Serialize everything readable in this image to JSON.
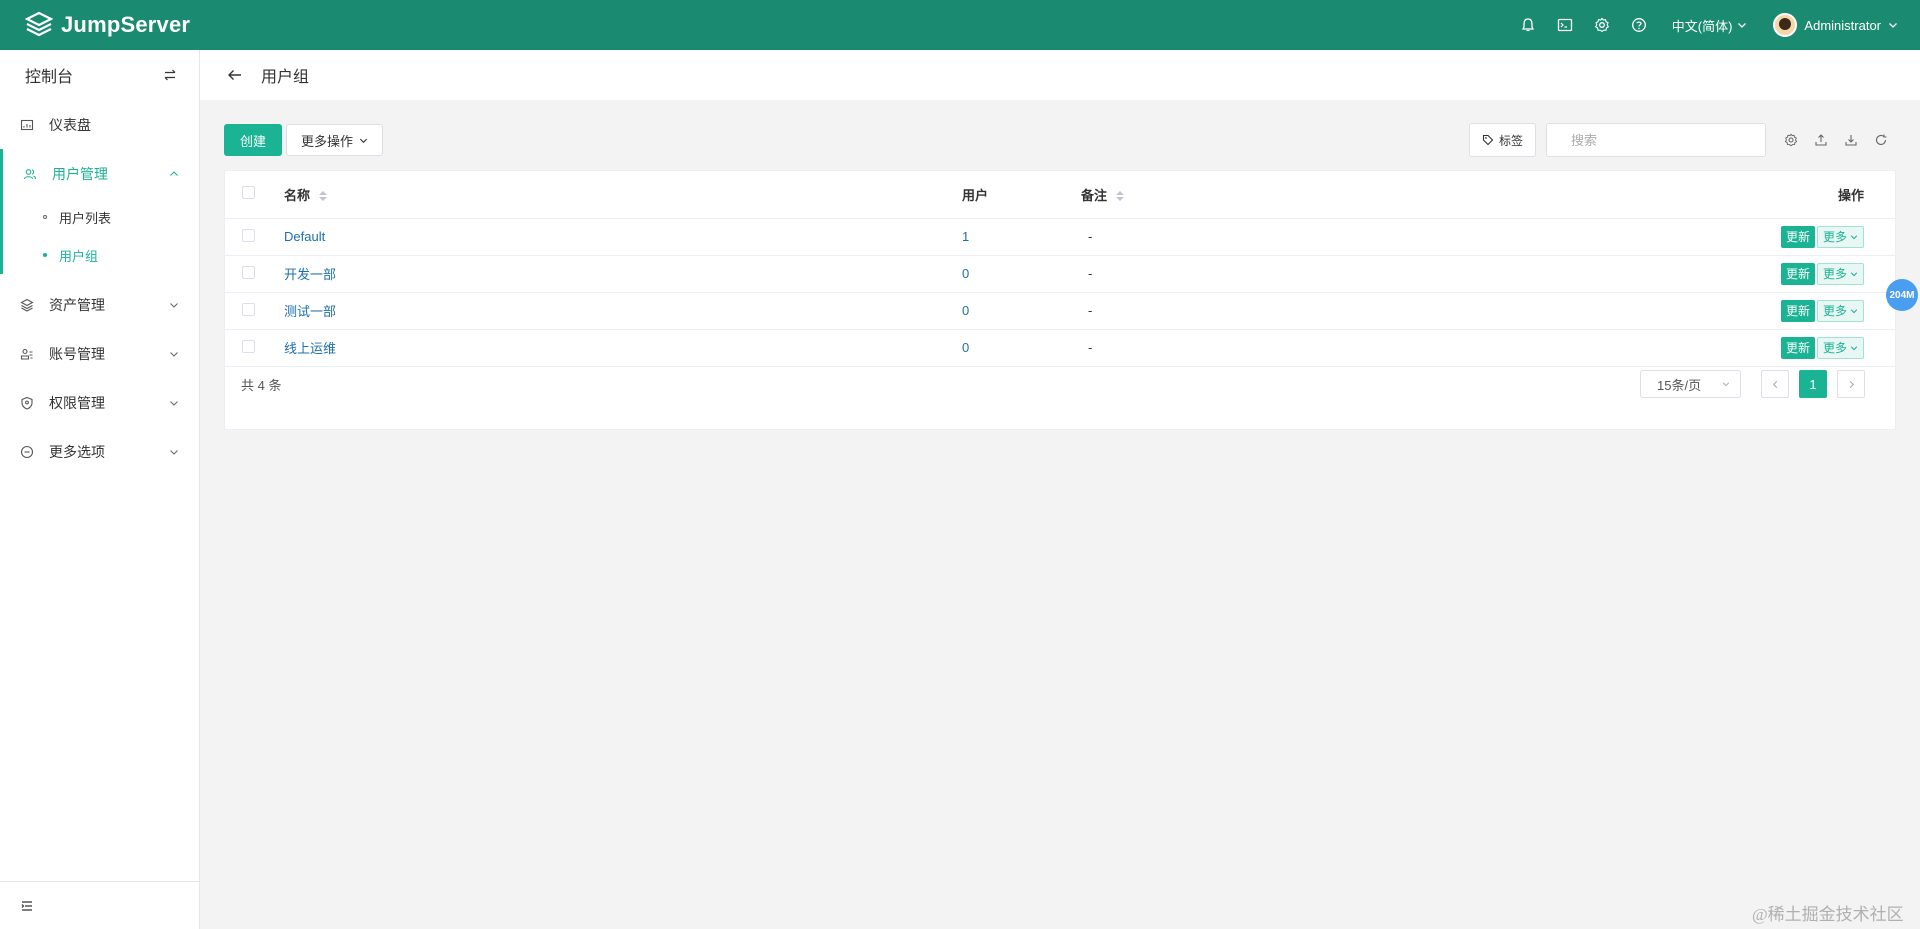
{
  "app": {
    "name": "JumpServer"
  },
  "topbar": {
    "icons": [
      "bell-icon",
      "terminal-icon",
      "gear-icon",
      "help-icon"
    ],
    "language": "中文(简体)",
    "user": "Administrator"
  },
  "sidebar": {
    "title": "控制台",
    "items": [
      {
        "label": "仪表盘",
        "icon": "dashboard-icon"
      },
      {
        "label": "用户管理",
        "icon": "users-icon",
        "open": true,
        "children": [
          {
            "label": "用户列表"
          },
          {
            "label": "用户组",
            "active": true
          }
        ]
      },
      {
        "label": "资产管理",
        "icon": "layers-icon"
      },
      {
        "label": "账号管理",
        "icon": "account-icon"
      },
      {
        "label": "权限管理",
        "icon": "shield-icon"
      },
      {
        "label": "更多选项",
        "icon": "more-icon"
      }
    ]
  },
  "page": {
    "title": "用户组"
  },
  "toolbar": {
    "create_label": "创建",
    "more_actions_label": "更多操作",
    "tag_label": "标签",
    "search_placeholder": "搜索"
  },
  "table": {
    "columns": {
      "name": "名称",
      "users": "用户",
      "remark": "备注",
      "actions": "操作"
    },
    "rows": [
      {
        "name": "Default",
        "users": "1",
        "remark": "-",
        "update": "更新",
        "more": "更多"
      },
      {
        "name": "开发一部",
        "users": "0",
        "remark": "-",
        "update": "更新",
        "more": "更多"
      },
      {
        "name": "测试一部",
        "users": "0",
        "remark": "-",
        "update": "更新",
        "more": "更多"
      },
      {
        "name": "线上运维",
        "users": "0",
        "remark": "-",
        "update": "更新",
        "more": "更多"
      }
    ]
  },
  "pagination": {
    "total_text": "共 4 条",
    "page_size": "15条/页",
    "current_page": "1"
  },
  "float_badge": "204M",
  "watermark": "@稀土掘金技术社区",
  "colors": {
    "brand": "#1a8b71",
    "accent": "#1ab394",
    "link": "#1c6fae"
  }
}
